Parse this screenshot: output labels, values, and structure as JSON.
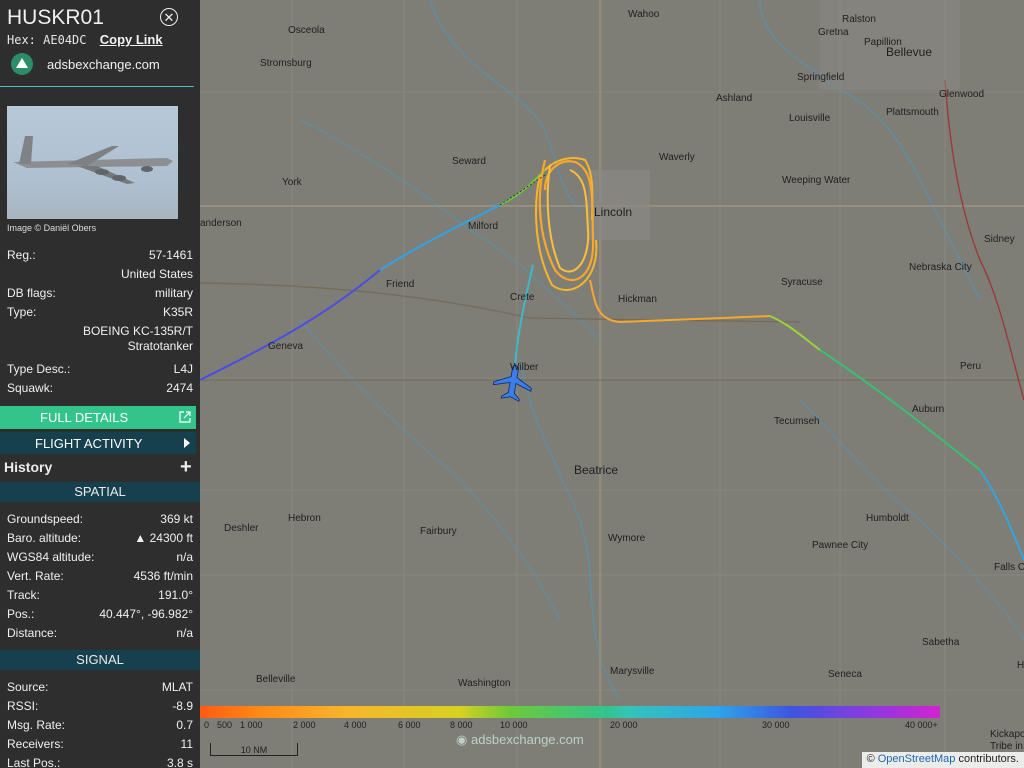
{
  "aircraft": {
    "callsign": "HUSKR01",
    "hex_label": "Hex:",
    "hex": "AE04DC",
    "copy_link": "Copy Link",
    "site": "adsbexchange.com",
    "close_icon": "close-icon",
    "photo_credit": "Image © Daniël Obers"
  },
  "details": {
    "reg_label": "Reg.:",
    "reg": "57-1461",
    "country": "United States",
    "dbflags_label": "DB flags:",
    "dbflags": "military",
    "type_label": "Type:",
    "type": "K35R",
    "model_line1": "BOEING KC-135R/T",
    "model_line2": "Stratotanker",
    "typedesc_label": "Type Desc.:",
    "typedesc": "L4J",
    "squawk_label": "Squawk:",
    "squawk": "2474"
  },
  "buttons": {
    "full_details": "FULL DETAILS",
    "flight_activity": "FLIGHT ACTIVITY",
    "history": "History",
    "external_icon": "external-link-icon",
    "chevron_icon": "chevron-right-icon",
    "plus_icon": "plus-icon"
  },
  "spatial": {
    "title": "SPATIAL",
    "rows": [
      {
        "label": "Groundspeed:",
        "value": "369 kt"
      },
      {
        "label": "Baro. altitude:",
        "value": "▲ 24300 ft"
      },
      {
        "label": "WGS84 altitude:",
        "value": "n/a"
      },
      {
        "label": "Vert. Rate:",
        "value": "4536 ft/min"
      },
      {
        "label": "Track:",
        "value": "191.0°"
      },
      {
        "label": "Pos.:",
        "value": "40.447°, -96.982°"
      },
      {
        "label": "Distance:",
        "value": "n/a"
      }
    ]
  },
  "signal": {
    "title": "SIGNAL",
    "rows": [
      {
        "label": "Source:",
        "value": "MLAT"
      },
      {
        "label": "RSSI:",
        "value": "-8.9"
      },
      {
        "label": "Msg. Rate:",
        "value": "0.7"
      },
      {
        "label": "Receivers:",
        "value": "11"
      },
      {
        "label": "Last Pos.:",
        "value": "3.8 s"
      }
    ]
  },
  "map": {
    "towns": [
      "Wahoo",
      "Ralston",
      "Osceola",
      "Gretna",
      "Papillion",
      "Bellevue",
      "Stromsburg",
      "Ashland",
      "Springfield",
      "Glenwood",
      "Louisville",
      "Plattsmouth",
      "Seward",
      "Waverly",
      "York",
      "Weeping Water",
      "Lincoln",
      "Milford",
      "Sidney",
      "Friend",
      "Crete",
      "Hickman",
      "Nebraska City",
      "Syracuse",
      "Geneva",
      "Wilber",
      "Peru",
      "Auburn",
      "Tecumseh",
      "Beatrice",
      "Deshler",
      "Hebron",
      "Fairbury",
      "Humboldt",
      "Wymore",
      "Pawnee City",
      "Falls C",
      "Sabetha",
      "Belleville",
      "Washington",
      "Marysville",
      "Seneca",
      "Kickapo",
      "Tribe in",
      "anderson",
      "H"
    ],
    "scale": "10 NM",
    "watermark": "adsbexchange.com",
    "attribution_prefix": "© ",
    "attribution_link": "OpenStreetMap",
    "attribution_suffix": " contributors.",
    "legend_labels": [
      "0",
      "500",
      "1 000",
      "2 000",
      "4 000",
      "6 000",
      "8 000",
      "10 000",
      "20 000",
      "30 000",
      "40 000+"
    ],
    "aircraft_icon": "airplane-icon"
  },
  "colors": {
    "accent_green": "#33c48c",
    "section_bg": "#16404e",
    "sidebar_bg": "#2e2e2e",
    "track_orange": "#f7a82c"
  }
}
